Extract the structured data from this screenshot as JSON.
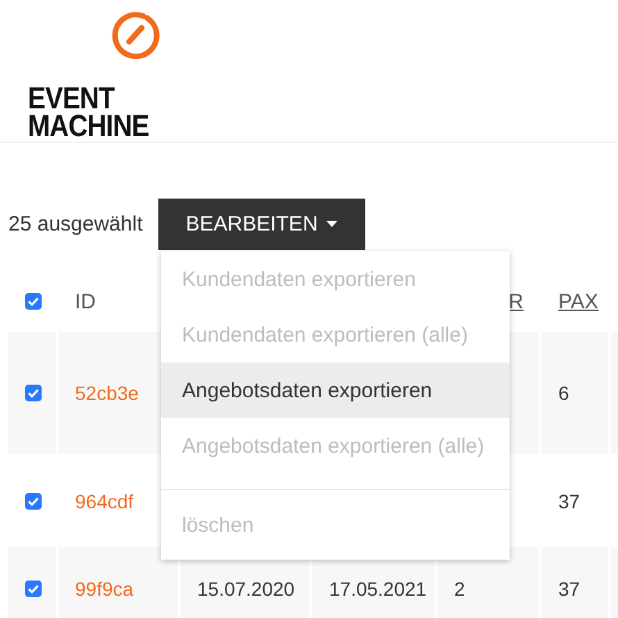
{
  "brand": {
    "name_line_1": "EVENT",
    "name_line_2": "MACHINE"
  },
  "toolbar": {
    "selection_count": "25 ausgewählt",
    "edit_button": "BEARBEITEN"
  },
  "menu": {
    "items": [
      {
        "kind": "action",
        "label": "Kundendaten exportieren",
        "disabled": true,
        "hovered": false
      },
      {
        "kind": "action",
        "label": "Kundendaten exportieren (alle)",
        "disabled": true,
        "hovered": false
      },
      {
        "kind": "action",
        "label": "Angebotsdaten exportieren",
        "disabled": false,
        "hovered": true
      },
      {
        "kind": "action",
        "label": "Angebotsdaten exportieren (alle)",
        "disabled": true,
        "hovered": false
      },
      {
        "kind": "divider"
      },
      {
        "kind": "action",
        "label": "löschen",
        "disabled": true,
        "hovered": false
      }
    ]
  },
  "table": {
    "select_all_checked": true,
    "columns": [
      {
        "label": "ID"
      },
      {},
      {},
      {
        "label": "R"
      },
      {
        "label": "PAX"
      }
    ],
    "rows": [
      {
        "selected": true,
        "id": "52cb3e",
        "cells": [
          null,
          null,
          null,
          "6"
        ]
      },
      {
        "selected": true,
        "id": "964cdf",
        "cells": [
          null,
          null,
          null,
          "37"
        ]
      },
      {
        "selected": true,
        "id": "99f9ca",
        "cells": [
          "15.07.2020",
          "17.05.2021",
          "2",
          "37"
        ]
      }
    ]
  }
}
